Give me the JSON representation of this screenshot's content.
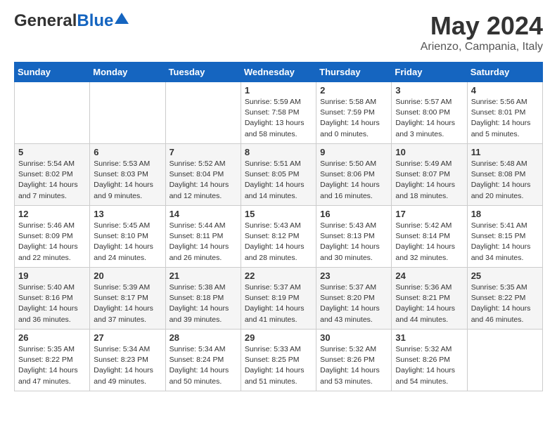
{
  "header": {
    "logo_general": "General",
    "logo_blue": "Blue",
    "title": "May 2024",
    "subtitle": "Arienzo, Campania, Italy"
  },
  "days_of_week": [
    "Sunday",
    "Monday",
    "Tuesday",
    "Wednesday",
    "Thursday",
    "Friday",
    "Saturday"
  ],
  "weeks": [
    [
      {
        "day": "",
        "info": ""
      },
      {
        "day": "",
        "info": ""
      },
      {
        "day": "",
        "info": ""
      },
      {
        "day": "1",
        "info": "Sunrise: 5:59 AM\nSunset: 7:58 PM\nDaylight: 13 hours\nand 58 minutes."
      },
      {
        "day": "2",
        "info": "Sunrise: 5:58 AM\nSunset: 7:59 PM\nDaylight: 14 hours\nand 0 minutes."
      },
      {
        "day": "3",
        "info": "Sunrise: 5:57 AM\nSunset: 8:00 PM\nDaylight: 14 hours\nand 3 minutes."
      },
      {
        "day": "4",
        "info": "Sunrise: 5:56 AM\nSunset: 8:01 PM\nDaylight: 14 hours\nand 5 minutes."
      }
    ],
    [
      {
        "day": "5",
        "info": "Sunrise: 5:54 AM\nSunset: 8:02 PM\nDaylight: 14 hours\nand 7 minutes."
      },
      {
        "day": "6",
        "info": "Sunrise: 5:53 AM\nSunset: 8:03 PM\nDaylight: 14 hours\nand 9 minutes."
      },
      {
        "day": "7",
        "info": "Sunrise: 5:52 AM\nSunset: 8:04 PM\nDaylight: 14 hours\nand 12 minutes."
      },
      {
        "day": "8",
        "info": "Sunrise: 5:51 AM\nSunset: 8:05 PM\nDaylight: 14 hours\nand 14 minutes."
      },
      {
        "day": "9",
        "info": "Sunrise: 5:50 AM\nSunset: 8:06 PM\nDaylight: 14 hours\nand 16 minutes."
      },
      {
        "day": "10",
        "info": "Sunrise: 5:49 AM\nSunset: 8:07 PM\nDaylight: 14 hours\nand 18 minutes."
      },
      {
        "day": "11",
        "info": "Sunrise: 5:48 AM\nSunset: 8:08 PM\nDaylight: 14 hours\nand 20 minutes."
      }
    ],
    [
      {
        "day": "12",
        "info": "Sunrise: 5:46 AM\nSunset: 8:09 PM\nDaylight: 14 hours\nand 22 minutes."
      },
      {
        "day": "13",
        "info": "Sunrise: 5:45 AM\nSunset: 8:10 PM\nDaylight: 14 hours\nand 24 minutes."
      },
      {
        "day": "14",
        "info": "Sunrise: 5:44 AM\nSunset: 8:11 PM\nDaylight: 14 hours\nand 26 minutes."
      },
      {
        "day": "15",
        "info": "Sunrise: 5:43 AM\nSunset: 8:12 PM\nDaylight: 14 hours\nand 28 minutes."
      },
      {
        "day": "16",
        "info": "Sunrise: 5:43 AM\nSunset: 8:13 PM\nDaylight: 14 hours\nand 30 minutes."
      },
      {
        "day": "17",
        "info": "Sunrise: 5:42 AM\nSunset: 8:14 PM\nDaylight: 14 hours\nand 32 minutes."
      },
      {
        "day": "18",
        "info": "Sunrise: 5:41 AM\nSunset: 8:15 PM\nDaylight: 14 hours\nand 34 minutes."
      }
    ],
    [
      {
        "day": "19",
        "info": "Sunrise: 5:40 AM\nSunset: 8:16 PM\nDaylight: 14 hours\nand 36 minutes."
      },
      {
        "day": "20",
        "info": "Sunrise: 5:39 AM\nSunset: 8:17 PM\nDaylight: 14 hours\nand 37 minutes."
      },
      {
        "day": "21",
        "info": "Sunrise: 5:38 AM\nSunset: 8:18 PM\nDaylight: 14 hours\nand 39 minutes."
      },
      {
        "day": "22",
        "info": "Sunrise: 5:37 AM\nSunset: 8:19 PM\nDaylight: 14 hours\nand 41 minutes."
      },
      {
        "day": "23",
        "info": "Sunrise: 5:37 AM\nSunset: 8:20 PM\nDaylight: 14 hours\nand 43 minutes."
      },
      {
        "day": "24",
        "info": "Sunrise: 5:36 AM\nSunset: 8:21 PM\nDaylight: 14 hours\nand 44 minutes."
      },
      {
        "day": "25",
        "info": "Sunrise: 5:35 AM\nSunset: 8:22 PM\nDaylight: 14 hours\nand 46 minutes."
      }
    ],
    [
      {
        "day": "26",
        "info": "Sunrise: 5:35 AM\nSunset: 8:22 PM\nDaylight: 14 hours\nand 47 minutes."
      },
      {
        "day": "27",
        "info": "Sunrise: 5:34 AM\nSunset: 8:23 PM\nDaylight: 14 hours\nand 49 minutes."
      },
      {
        "day": "28",
        "info": "Sunrise: 5:34 AM\nSunset: 8:24 PM\nDaylight: 14 hours\nand 50 minutes."
      },
      {
        "day": "29",
        "info": "Sunrise: 5:33 AM\nSunset: 8:25 PM\nDaylight: 14 hours\nand 51 minutes."
      },
      {
        "day": "30",
        "info": "Sunrise: 5:32 AM\nSunset: 8:26 PM\nDaylight: 14 hours\nand 53 minutes."
      },
      {
        "day": "31",
        "info": "Sunrise: 5:32 AM\nSunset: 8:26 PM\nDaylight: 14 hours\nand 54 minutes."
      },
      {
        "day": "",
        "info": ""
      }
    ]
  ]
}
